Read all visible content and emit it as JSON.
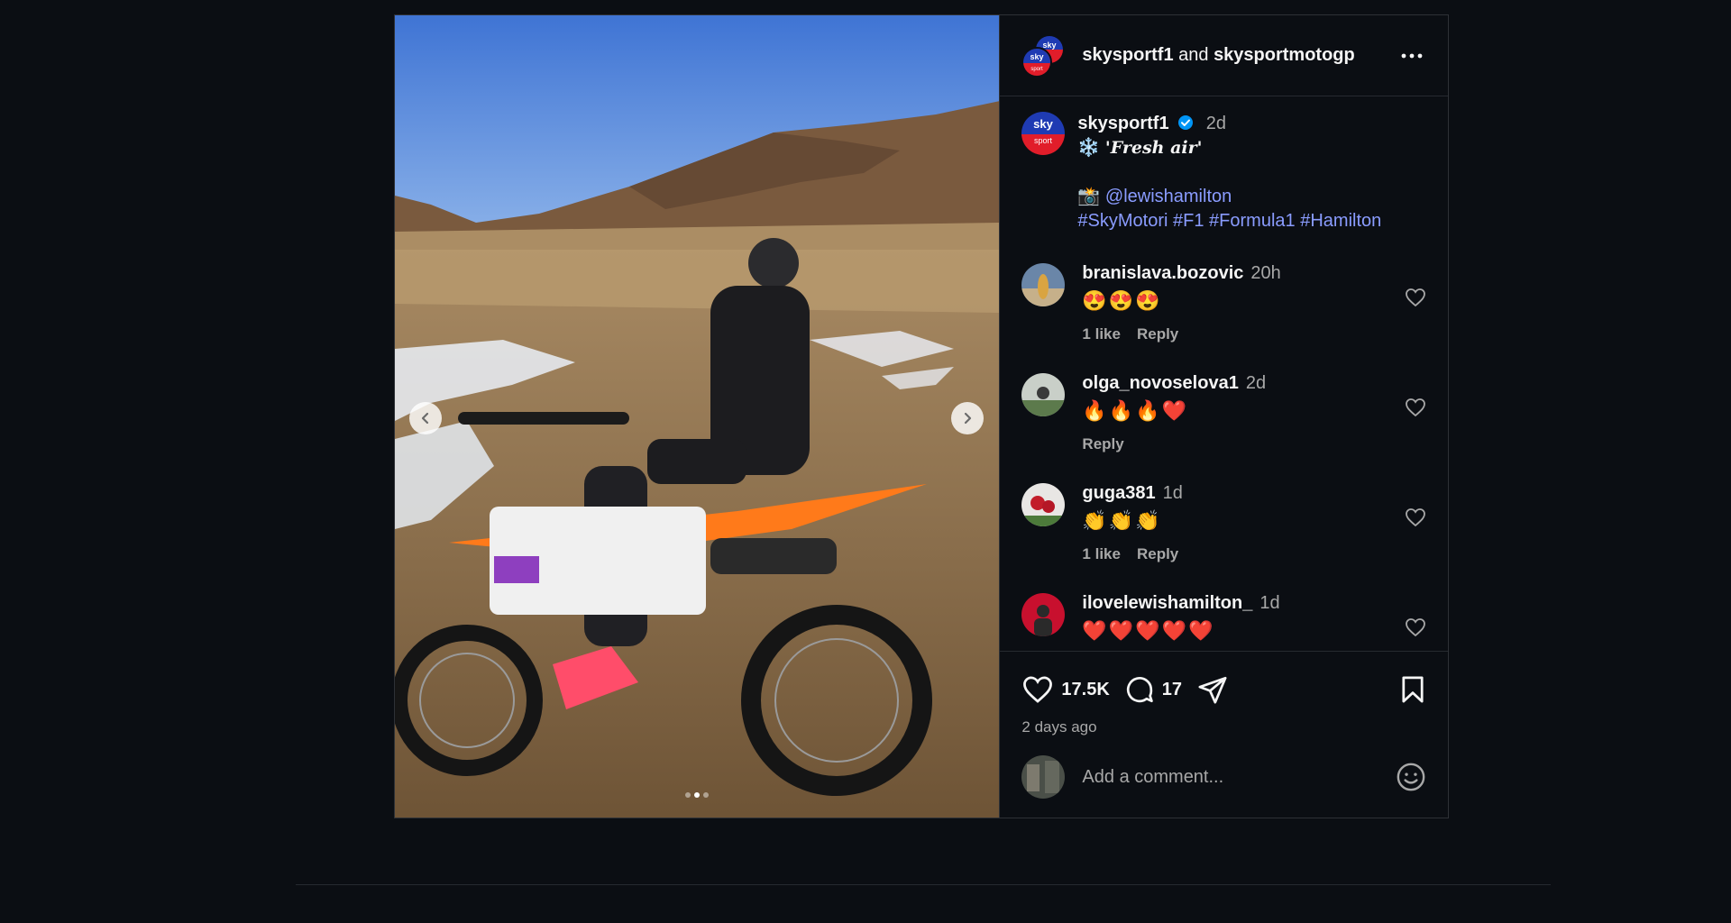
{
  "post": {
    "header": {
      "account_1": "skysportf1",
      "and_text": " and ",
      "account_2": "skysportmotogp"
    },
    "caption": {
      "username": "skysportf1",
      "time": "2d",
      "title_emoji": "❄️",
      "title": "'Fresh air'",
      "camera_emoji": "📸",
      "mention": "@lewishamilton",
      "hashtags": [
        "#SkyMotori",
        "#F1",
        "#Formula1",
        "#Hamilton"
      ]
    },
    "comments": [
      {
        "username": "branislava.bozovic",
        "time": "20h",
        "text": "😍😍😍",
        "likes": "1 like",
        "reply": "Reply"
      },
      {
        "username": "olga_novoselova1",
        "time": "2d",
        "text": "🔥🔥🔥❤️",
        "likes": "",
        "reply": "Reply"
      },
      {
        "username": "guga381",
        "time": "1d",
        "text": "👏👏👏",
        "likes": "1 like",
        "reply": "Reply"
      },
      {
        "username": "ilovelewishamilton_",
        "time": "1d",
        "text": "❤️❤️❤️❤️❤️",
        "likes": "",
        "reply": ""
      }
    ],
    "stats": {
      "likes": "17.5K",
      "comments": "17",
      "posted": "2 days ago"
    },
    "add_comment_placeholder": "Add a comment...",
    "logo_text": {
      "sky": "sky",
      "sport": "sport"
    },
    "carousel": {
      "slides": 3,
      "active_slide": 2
    }
  },
  "colors": {
    "background": "#0b0e13",
    "link": "#8a9cff",
    "verified": "#0095f6",
    "sky_blue": "#1f3bb3",
    "sky_red": "#e11d2a"
  }
}
